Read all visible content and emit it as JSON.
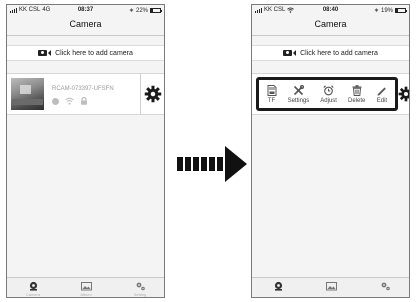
{
  "left_phone": {
    "status": {
      "carrier": "KK CSL",
      "network": "4G",
      "time": "08:37",
      "battery": "22%",
      "battery_level": 0.22
    },
    "nav_title": "Camera",
    "add_camera_label": "Click here to add camera",
    "camera": {
      "id": "RCAM-073397-UFSFN"
    },
    "tabs": [
      {
        "label": "Camera",
        "icon": "camera-tab-icon"
      },
      {
        "label": "Album",
        "icon": "album-tab-icon"
      },
      {
        "label": "Setting",
        "icon": "settings-tab-icon"
      }
    ]
  },
  "right_phone": {
    "status": {
      "carrier": "KK CSL",
      "time": "08:40",
      "battery": "19%",
      "battery_level": 0.19
    },
    "nav_title": "Camera",
    "add_camera_label": "Click here to add camera",
    "toolbar": [
      {
        "label": "TF",
        "icon": "tf-card-icon"
      },
      {
        "label": "Settings",
        "icon": "tools-icon"
      },
      {
        "label": "Adjust",
        "icon": "alarm-clock-icon"
      },
      {
        "label": "Delete",
        "icon": "trash-icon"
      },
      {
        "label": "Edit",
        "icon": "pencil-icon"
      }
    ]
  },
  "colors": {
    "highlight_border": "#1a1a1a",
    "arrow": "#111111"
  }
}
